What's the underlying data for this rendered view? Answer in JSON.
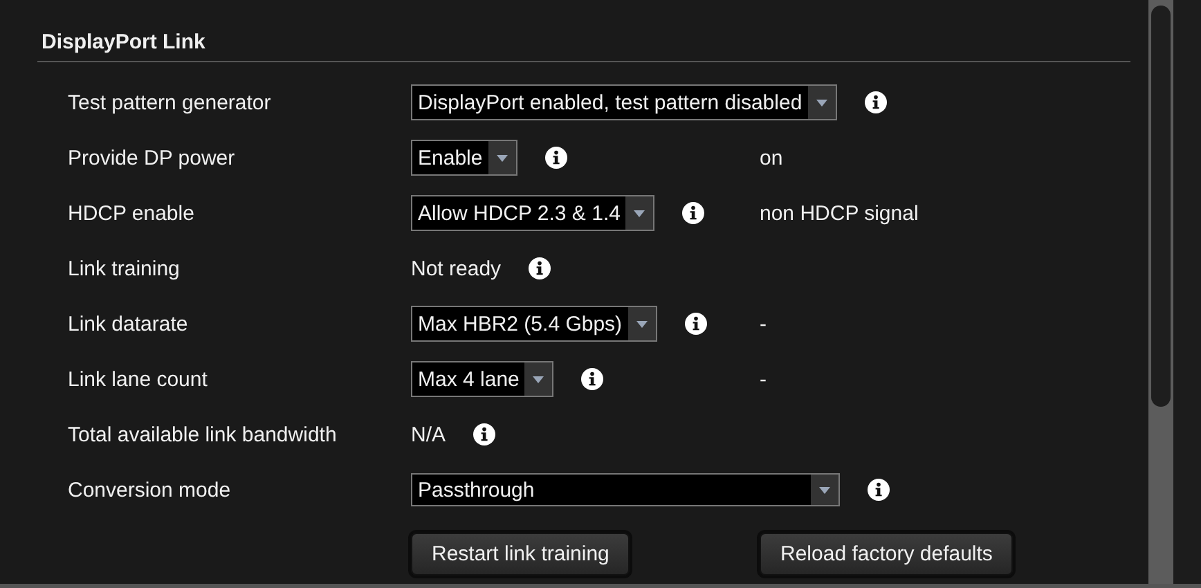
{
  "section": {
    "title": "DisplayPort Link"
  },
  "rows": [
    {
      "label": "Test pattern generator",
      "kind": "select",
      "value": "DisplayPort enabled, test pattern disabled",
      "info": true
    },
    {
      "label": "Provide DP power",
      "kind": "select",
      "value": "Enable",
      "info": true,
      "status": "on"
    },
    {
      "label": "HDCP enable",
      "kind": "select",
      "value": "Allow HDCP 2.3 & 1.4",
      "info": true,
      "status": "non HDCP signal"
    },
    {
      "label": "Link training",
      "kind": "text",
      "value": "Not ready",
      "info": true
    },
    {
      "label": "Link datarate",
      "kind": "select",
      "value": "Max HBR2 (5.4 Gbps)",
      "info": true,
      "status": "-"
    },
    {
      "label": "Link lane count",
      "kind": "select",
      "value": "Max 4 lane",
      "info": true,
      "status": "-"
    },
    {
      "label": "Total available link bandwidth",
      "kind": "text",
      "value": "N/A",
      "info": true
    },
    {
      "label": "Conversion mode",
      "kind": "select",
      "value": "Passthrough",
      "info": true,
      "stretch": true
    }
  ],
  "buttons": [
    "Restart link training",
    "Reload factory defaults"
  ]
}
